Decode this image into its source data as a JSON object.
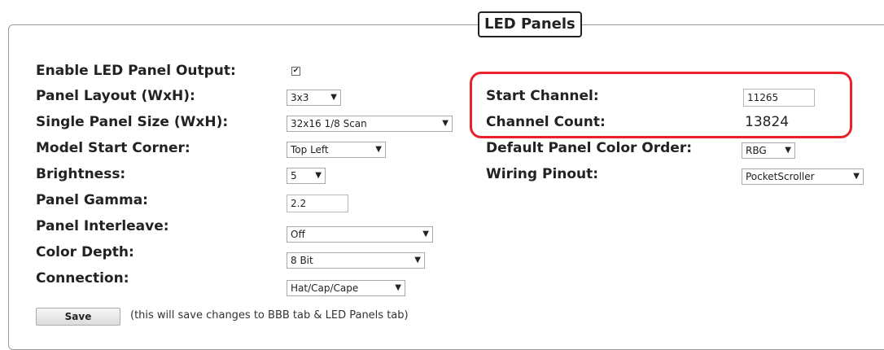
{
  "section_title": "LED Panels",
  "enable_output": {
    "label": "Enable LED Panel Output:",
    "checked": true,
    "check_glyph": "✔"
  },
  "left_fields": [
    {
      "label": "Panel Layout (WxH):",
      "value": "3x3",
      "type": "select"
    },
    {
      "label": "Single Panel Size (WxH):",
      "value": "32x16 1/8 Scan",
      "type": "select"
    },
    {
      "label": "Model Start Corner:",
      "value": "Top Left",
      "type": "select"
    },
    {
      "label": "Brightness:",
      "value": "5",
      "type": "select"
    },
    {
      "label": "Panel Gamma:",
      "value": "2.2",
      "type": "input"
    },
    {
      "label": "Panel Interleave:",
      "value": "Off",
      "type": "select"
    },
    {
      "label": "Color Depth:",
      "value": "8 Bit",
      "type": "select"
    },
    {
      "label": "Connection:",
      "value": "Hat/Cap/Cape",
      "type": "select"
    }
  ],
  "right_fields": [
    {
      "label": "Start Channel:",
      "value": "11265",
      "type": "input"
    },
    {
      "label": "Channel Count:",
      "value": "13824",
      "type": "text"
    },
    {
      "label": "Default Panel Color Order:",
      "value": "RBG",
      "type": "select"
    },
    {
      "label": "Wiring Pinout:",
      "value": "PocketScroller",
      "type": "select"
    }
  ],
  "dropdown_arrow": "▼",
  "save_button": "Save",
  "save_note": "(this will save changes to BBB tab & LED Panels tab)",
  "colors": {
    "highlight": "#e8212a",
    "border": "#9a9a9a"
  }
}
